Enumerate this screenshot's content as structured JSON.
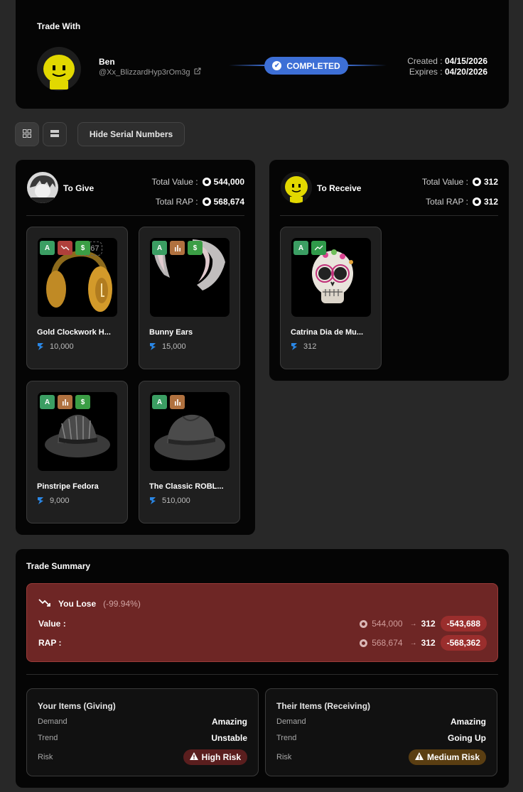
{
  "header": {
    "title": "Trade With",
    "partner_name": "Ben",
    "partner_handle": "@Xx_BlizzardHyp3rOm3g",
    "status": "COMPLETED",
    "created_label": "Created :",
    "created_value": "04/15/2026",
    "expires_label": "Expires :",
    "expires_value": "04/20/2026"
  },
  "toolbar": {
    "hide_serials_label": "Hide Serial Numbers"
  },
  "give": {
    "title": "To Give",
    "total_value_label": "Total Value :",
    "total_value": "544,000",
    "total_rap_label": "Total RAP :",
    "total_rap": "568,674",
    "items": [
      {
        "name": "Gold Clockwork H...",
        "value": "10,000",
        "serial": "#267",
        "badges": [
          "A",
          "down",
          "$"
        ]
      },
      {
        "name": "Bunny Ears",
        "value": "15,000",
        "badges": [
          "A",
          "bars",
          "$"
        ]
      },
      {
        "name": "Pinstripe Fedora",
        "value": "9,000",
        "badges": [
          "A",
          "bars",
          "$"
        ]
      },
      {
        "name": "The Classic ROBL...",
        "value": "510,000",
        "badges": [
          "A",
          "bars"
        ]
      }
    ]
  },
  "receive": {
    "title": "To Receive",
    "total_value_label": "Total Value :",
    "total_value": "312",
    "total_rap_label": "Total RAP :",
    "total_rap": "312",
    "items": [
      {
        "name": "Catrina Dia de Mu...",
        "value": "312",
        "badges": [
          "A",
          "up"
        ]
      }
    ]
  },
  "summary": {
    "title": "Trade Summary",
    "result_label": "You Lose",
    "result_pct": "(-99.94%)",
    "value_label": "Value :",
    "value_from": "544,000",
    "value_to": "312",
    "value_delta": "-543,688",
    "rap_label": "RAP :",
    "rap_from": "568,674",
    "rap_to": "312",
    "rap_delta": "-568,362",
    "arrow": "→",
    "yours": {
      "title": "Your Items (Giving)",
      "demand_label": "Demand",
      "demand": "Amazing",
      "trend_label": "Trend",
      "trend": "Unstable",
      "risk_label": "Risk",
      "risk": "High Risk"
    },
    "theirs": {
      "title": "Their Items (Receiving)",
      "demand_label": "Demand",
      "demand": "Amazing",
      "trend_label": "Trend",
      "trend": "Going Up",
      "risk_label": "Risk",
      "risk": "Medium Risk"
    }
  },
  "colors": {
    "accent": "#3d6fd6",
    "loss_bg": "#6e2625",
    "high_risk": "#5a1e1e",
    "medium_risk": "#5a3e12"
  }
}
